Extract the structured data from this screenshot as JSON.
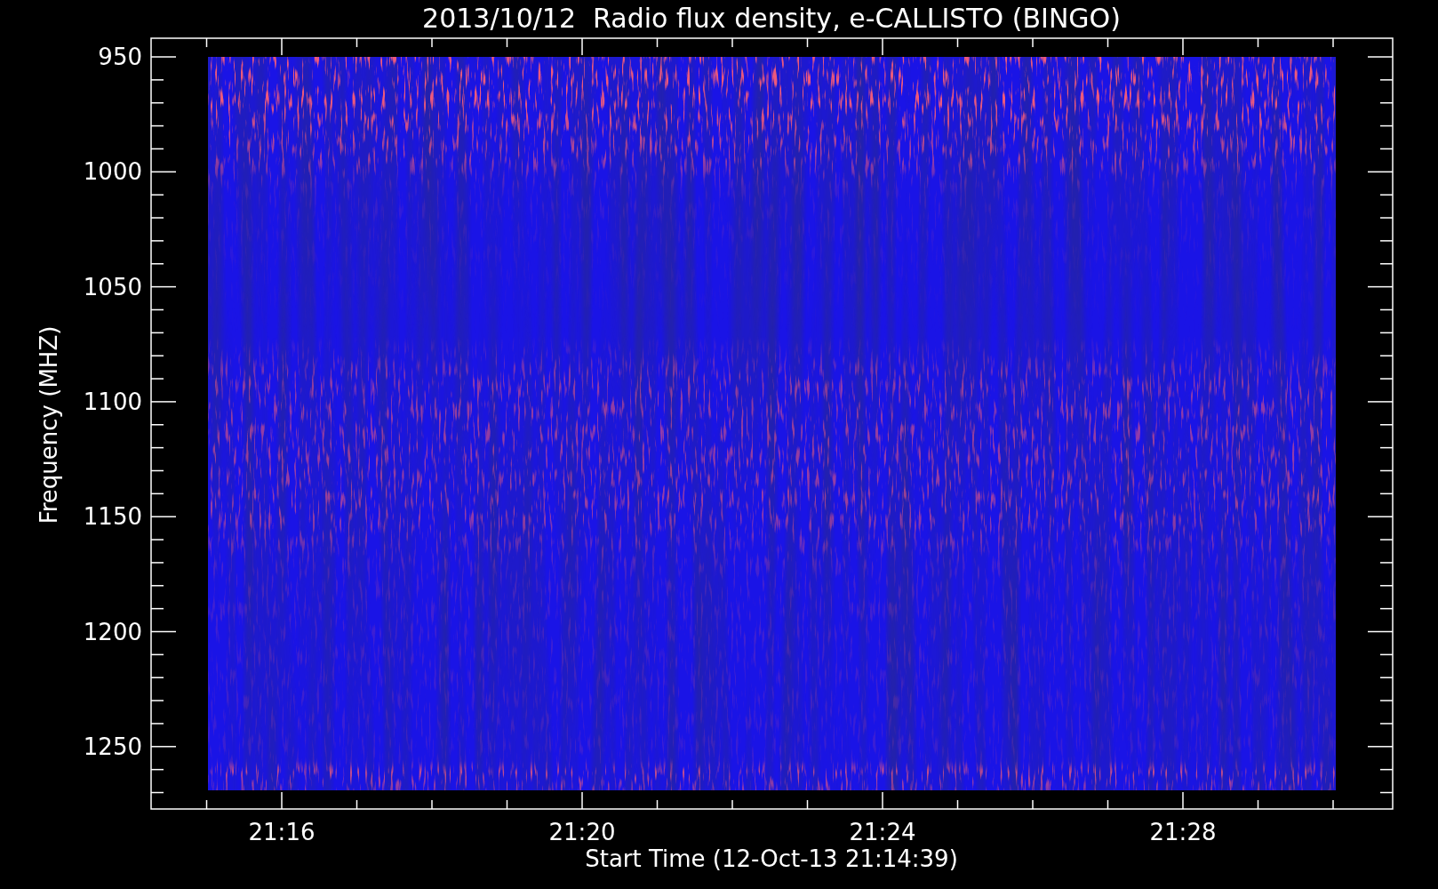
{
  "title": "2013/10/12  Radio flux density, e-CALLISTO (BINGO)",
  "y_axis": {
    "label": "Frequency (MHZ)",
    "ticks": [
      "950",
      "1000",
      "1050",
      "1100",
      "1150",
      "1200",
      "1250"
    ]
  },
  "x_axis": {
    "label": "Start Time (12-Oct-13 21:14:39)",
    "ticks": [
      "21:16",
      "21:20",
      "21:24",
      "21:28"
    ]
  }
}
